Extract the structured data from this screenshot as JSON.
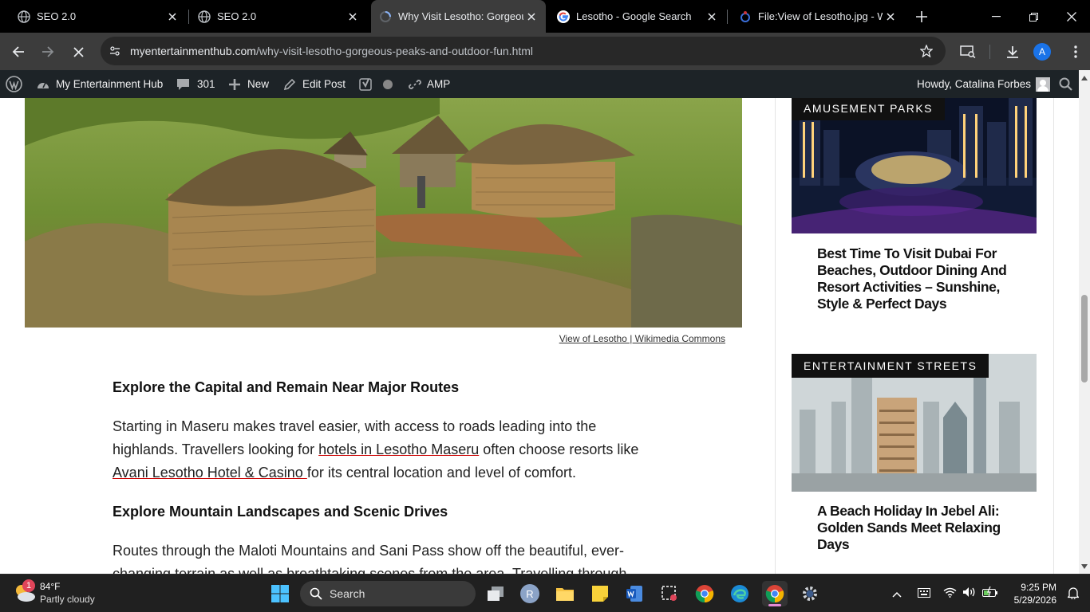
{
  "tabs": [
    {
      "title": "SEO 2.0",
      "active": false
    },
    {
      "title": "SEO 2.0",
      "active": false
    },
    {
      "title": "Why Visit Lesotho: Gorgeou",
      "active": true
    },
    {
      "title": "Lesotho - Google Search",
      "active": false
    },
    {
      "title": "File:View of Lesotho.jpg - W",
      "active": false
    }
  ],
  "address": {
    "host": "myentertainmenthub.com",
    "path": "/why-visit-lesotho-gorgeous-peaks-and-outdoor-fun.html"
  },
  "profile_letter": "A",
  "adminbar": {
    "site_name": "My Entertainment Hub",
    "comments_count": "301",
    "new_label": "New",
    "edit_label": "Edit Post",
    "amp_label": "AMP",
    "howdy": "Howdy, Catalina Forbes"
  },
  "article": {
    "image_caption": "View of Lesotho | Wikimedia Commons",
    "heading1": "Explore the Capital and Remain Near Major Routes",
    "para1_a": "Starting in Maseru makes travel easier, with access to roads leading into the highlands. Travellers looking for ",
    "link1": "hotels in Lesotho Maseru",
    "para1_b": " often choose resorts like ",
    "link2": "Avani Lesotho Hotel & Casino ",
    "para1_c": "for its central location and level of comfort.",
    "heading2": "Explore Mountain Landscapes and Scenic Drives",
    "para2": "Routes through the Maloti Mountains and Sani Pass show off the beautiful, ever-changing terrain as well as breathtaking scenes from the area. Travelling through"
  },
  "sidebar": {
    "card1": {
      "badge": "AMUSEMENT PARKS",
      "title": "Best Time To Visit Dubai For Beaches, Outdoor Dining And Resort Activities – Sunshine, Style & Perfect Days"
    },
    "card2": {
      "badge": "ENTERTAINMENT STREETS",
      "title": "A Beach Holiday In Jebel Ali: Golden Sands Meet Relaxing Days"
    }
  },
  "taskbar": {
    "weather_temp": "84°F",
    "weather_desc": "Partly cloudy",
    "weather_badge": "1",
    "search_label": "Search",
    "time": "9:25 PM",
    "date": "5/29/2026"
  },
  "colors": {
    "tabstrip": "#000000",
    "toolbar": "#3c3c3c",
    "adminbar": "#1d2327",
    "link_underline": "#cc0000",
    "accent_blue": "#1a73e8"
  }
}
